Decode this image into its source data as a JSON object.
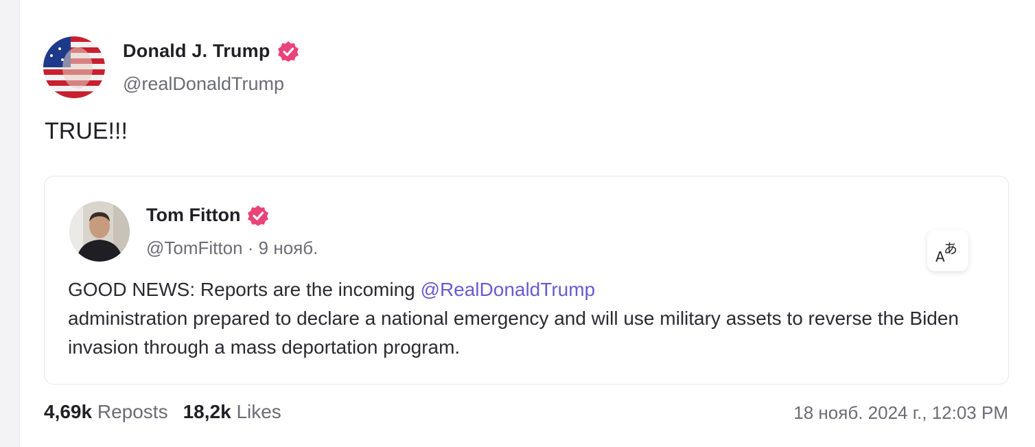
{
  "post": {
    "author": {
      "display_name": "Donald J. Trump",
      "handle": "@realDonaldTrump",
      "verified_icon": "verified-badge-icon"
    },
    "text": "TRUE!!!",
    "quote": {
      "author": {
        "display_name": "Tom Fitton",
        "handle": "@TomFitton",
        "date": "· 9 нояб."
      },
      "text_prefix": "GOOD NEWS: Reports are the incoming ",
      "mention": "@RealDonaldTrump",
      "text_suffix": " administration prepared to declare a national emergency and will use military assets to reverse the Biden invasion through a mass deportation program.",
      "translate_icon": "translate-icon"
    },
    "stats": {
      "reposts_count": "4,69k",
      "reposts_label": "Reposts",
      "likes_count": "18,2k",
      "likes_label": "Likes"
    },
    "timestamp": "18 нояб. 2024 г., 12:03 PM"
  },
  "colors": {
    "verified": "#e9437a",
    "mention": "#6a5ad0",
    "muted_text": "#6b6b75"
  }
}
